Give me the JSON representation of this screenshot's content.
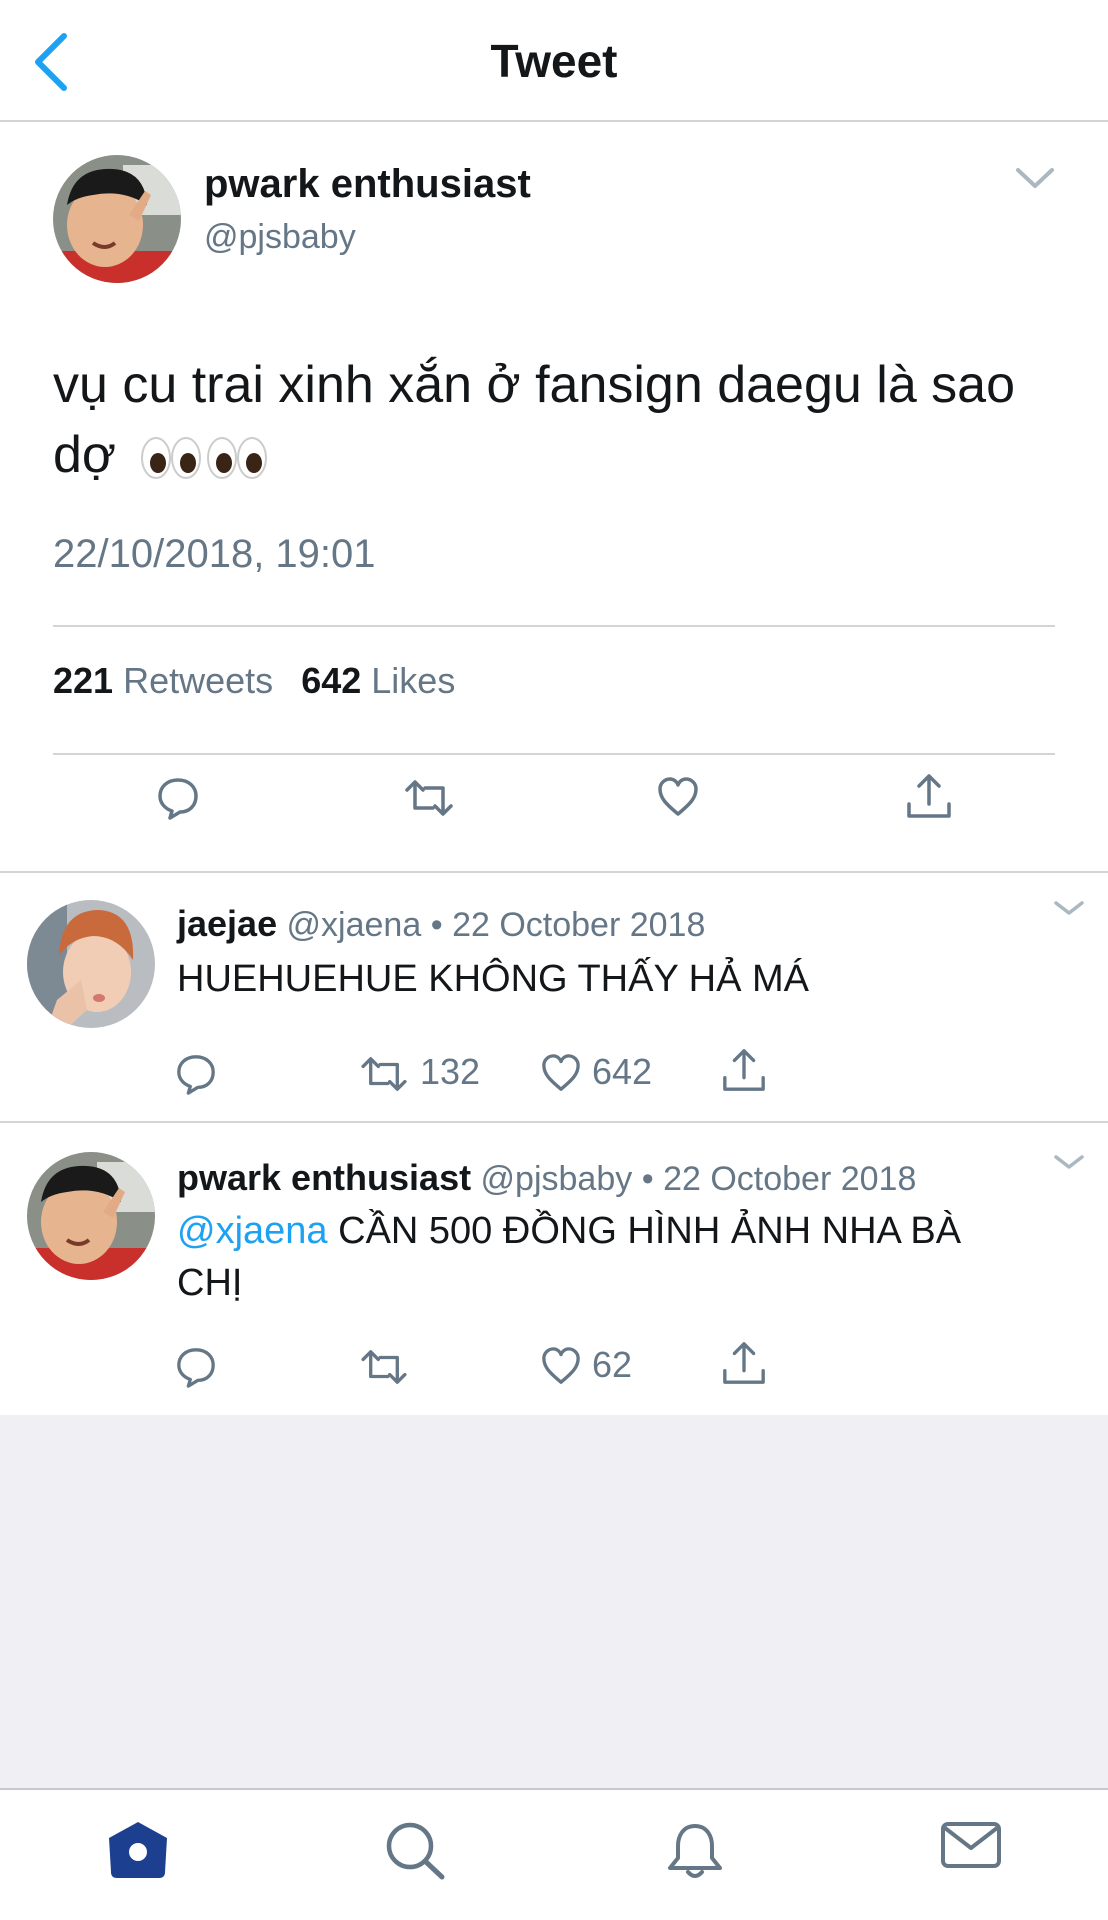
{
  "header": {
    "title": "Tweet",
    "back_icon": "chevron-left-icon"
  },
  "main_tweet": {
    "author_name": "pwark enthusiast",
    "author_handle": "@pjsbaby",
    "text": "vụ cu trai xinh xắn ở fansign daegu là sao dợ",
    "emoji": "eyes-emoji",
    "timestamp": "22/10/2018, 19:01",
    "retweets_count": "221",
    "retweets_label": "Retweets",
    "likes_count": "642",
    "likes_label": "Likes",
    "accent_color": "#1da1f2"
  },
  "replies": [
    {
      "author_name": "jaejae",
      "author_handle": "@xjaena",
      "date": "• 22 October 2018",
      "text": "HUEHUEHUE KHÔNG THẤY HẢ MÁ",
      "retweets": "132",
      "likes": "642"
    },
    {
      "author_name": "pwark enthusiast",
      "author_handle": "@pjsbaby",
      "date": "• 22 October 2018",
      "mention": "@xjaena",
      "text": "CẦN 500 ĐỒNG HÌNH ẢNH NHA BÀ CHỊ",
      "likes": "62"
    }
  ],
  "tabbar": {
    "items": [
      "home-icon",
      "search-icon",
      "notifications-icon",
      "messages-icon"
    ],
    "active_color": "#1d3f8f"
  }
}
